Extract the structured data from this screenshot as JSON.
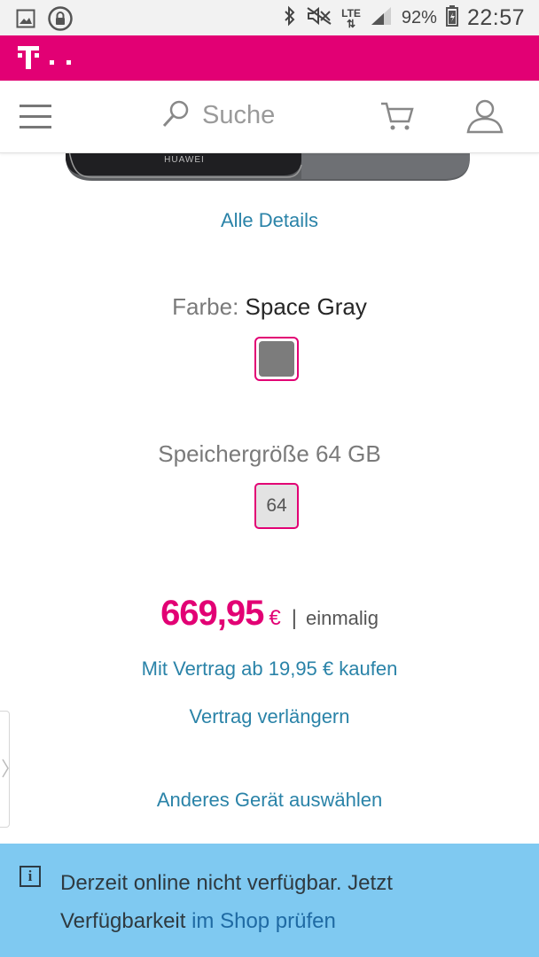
{
  "status_bar": {
    "battery": "92%",
    "time": "22:57",
    "network": "LTE",
    "icons": [
      "image-icon",
      "lock-icon",
      "bluetooth-icon",
      "mute-icon",
      "signal-icon",
      "battery-icon"
    ]
  },
  "brand": {
    "logo": "T · ·",
    "color": "#e20074"
  },
  "nav": {
    "search_placeholder": "Suche",
    "icons": [
      "menu-icon",
      "search-icon",
      "cart-icon",
      "user-icon"
    ]
  },
  "product": {
    "brand_on_device": "HUAWEI",
    "details_link": "Alle Details",
    "color_label": "Farbe:",
    "color_value": "Space Gray",
    "color_swatch": "#7c7c7c",
    "storage_label": "Speichergröße 64 GB",
    "storage_option": "64"
  },
  "pricing": {
    "amount": "669,95",
    "currency": "€",
    "separator": "|",
    "period": "einmalig",
    "contract_link": "Mit Vertrag ab 19,95 € kaufen",
    "extend_link": "Vertrag verlängern",
    "other_device_link": "Anderes Gerät auswählen"
  },
  "notice": {
    "text_1": "Derzeit online nicht verfügbar. Jetzt",
    "text_2": "Verfügbarkeit",
    "link": "im Shop prüfen",
    "background": "#7fc9f1"
  },
  "colors": {
    "accent": "#e20074",
    "link": "#2a83a8"
  }
}
